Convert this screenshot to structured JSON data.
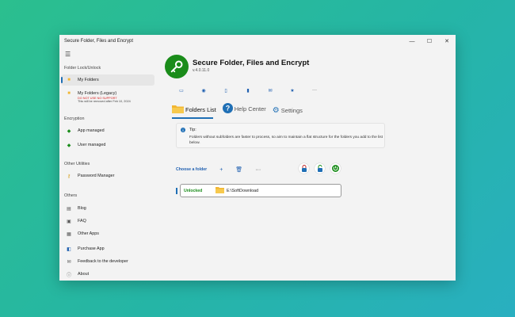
{
  "window": {
    "title": "Secure Folder, Files and Encrypt",
    "controls": {
      "minimize": "—",
      "maximize": "☐",
      "close": "✕"
    }
  },
  "sidebar": {
    "sections": {
      "folder_lock": "Folder Lock/Unlock",
      "encryption": "Encryption",
      "other_utilities": "Other Utilities",
      "others": "Others"
    },
    "items": {
      "my_folders": "My Folders",
      "my_folders_legacy": "My Folders (Legacy)",
      "legacy_warning": "DO NOT USE NO SUPPORT",
      "legacy_note": "This will be removed after Feb 10, 2024",
      "app_managed": "App managed",
      "user_managed": "User managed",
      "password_manager": "Password Manager",
      "blog": "Blog",
      "faq": "FAQ",
      "other_apps": "Other Apps",
      "purchase_app": "Purchase App",
      "feedback": "Feedback to the developer",
      "about": "About"
    }
  },
  "app": {
    "title": "Secure Folder, Files and Encrypt",
    "version": "v.4.0.11.0"
  },
  "tabs": {
    "folders_list": "Folders List",
    "help_center": "Help Center",
    "settings": "Settings"
  },
  "tip": {
    "title": "Tip:",
    "text": "Folders without subfolders are faster to process, so aim to maintain a flat structure for the folders you add to the list below."
  },
  "actions": {
    "choose_folder": "Choose a folder",
    "add": "+",
    "more": "···"
  },
  "folder_row": {
    "status": "Unlocked",
    "path": "E:\\SoftDownload"
  },
  "colors": {
    "accent": "#1f6fb5",
    "logo_green": "#1a8c1a",
    "warning_red": "#d92020",
    "folder_yellow": "#f2b632"
  }
}
